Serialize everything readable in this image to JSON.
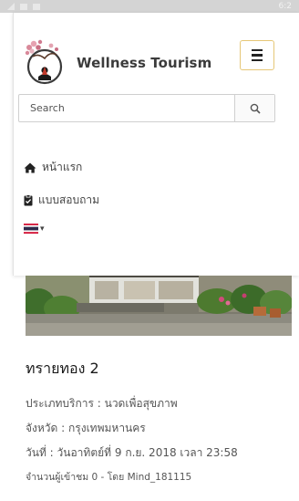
{
  "status_bar": {
    "time": "6:2"
  },
  "header": {
    "brand": "Wellness Tourism",
    "toggle_icon": "hamburger-icon"
  },
  "search": {
    "placeholder": "Search",
    "button_icon": "search-icon"
  },
  "nav": {
    "items": [
      {
        "icon": "home-icon",
        "label": "หน้าแรก"
      },
      {
        "icon": "clipboard-icon",
        "label": "แบบสอบถาม"
      }
    ],
    "language": {
      "icon": "thai-flag-icon",
      "caret": "▾"
    }
  },
  "place": {
    "name": "ทรายทอง 2",
    "service_type": "ประเภทบริการ : นวดเพื่อสุขภาพ",
    "province": "จังหวัด : กรุงเทพมหานคร",
    "date": "วันที่ : วันอาทิตย์ที่ 9 ก.ย. 2018 เวลา 23:58",
    "visitors": "จำนวนผู้เข้าชม 0 - โดย Mind_181115"
  },
  "colors": {
    "toggle_border": "#e6c777",
    "brand_text": "#3b3b3b",
    "status_bar": "#d4d4d4"
  }
}
